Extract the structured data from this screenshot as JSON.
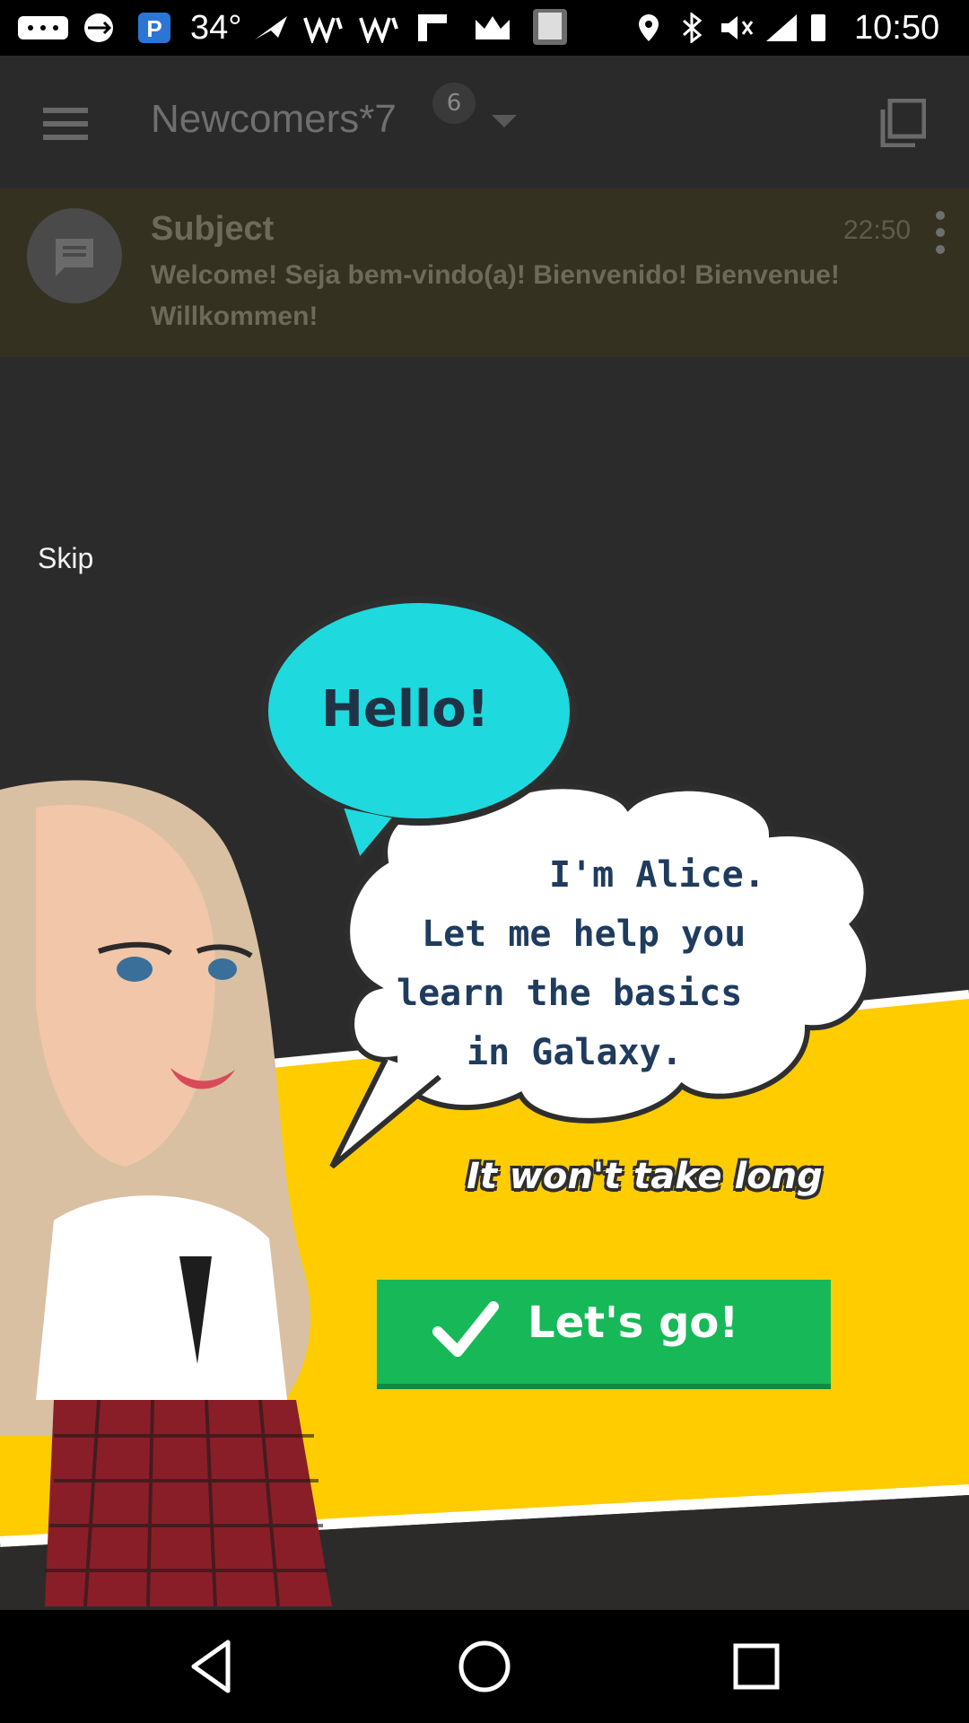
{
  "status_bar": {
    "temperature": "34°",
    "time": "10:50"
  },
  "app_bar": {
    "title": "Newcomers*7",
    "badge_count": "6"
  },
  "message": {
    "subject": "Subject",
    "time": "22:50",
    "body": "Welcome! Seja bem-vindo(a)! Bienvenido! Bienvenue! Willkommen!"
  },
  "overlay": {
    "skip_label": "Skip",
    "hello": "Hello!",
    "intro_lines": [
      "I'm Alice.",
      "Let me help you",
      "learn the basics",
      "in Galaxy."
    ],
    "subtitle": "It won't take long",
    "cta_label": "Let's go!"
  },
  "colors": {
    "accent_yellow": "#ffcc00",
    "cta_green": "#17b857",
    "hello_bubble": "#1ed9de"
  }
}
